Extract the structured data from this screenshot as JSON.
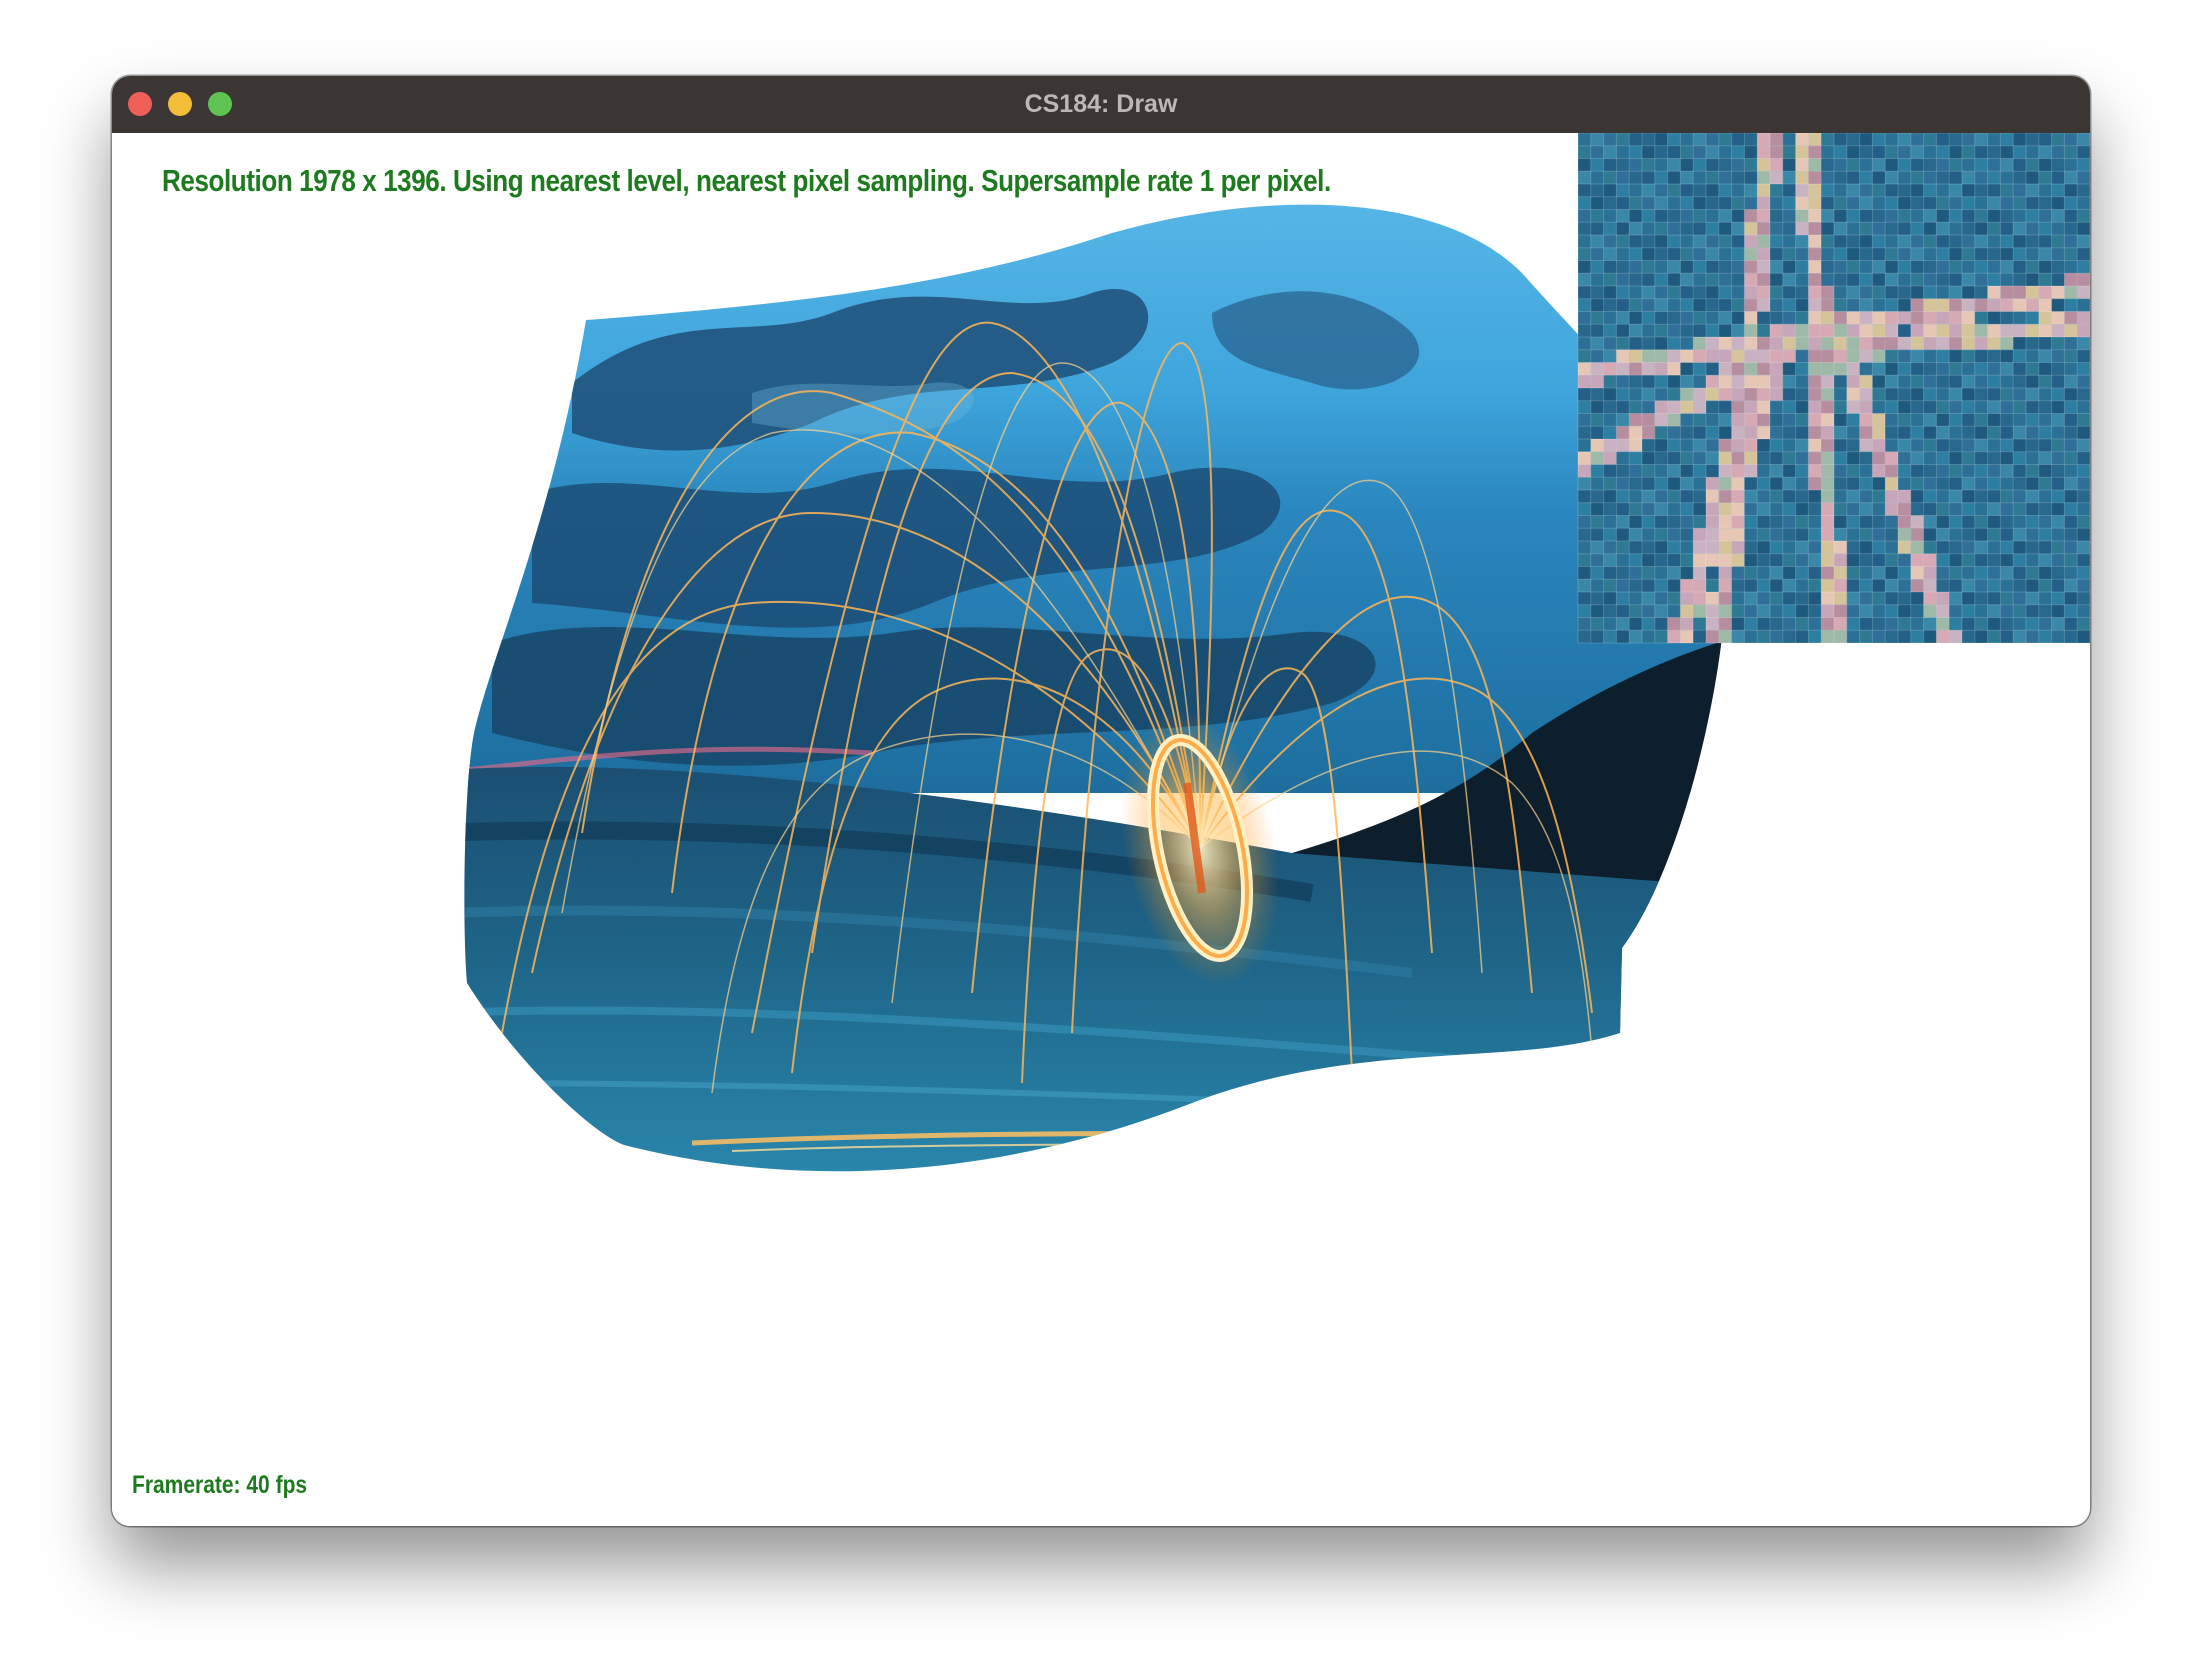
{
  "window": {
    "title": "CS184: Draw"
  },
  "overlay": {
    "status": "Resolution 1978 x 1396. Using nearest level, nearest pixel sampling. Supersample rate 1 per pixel.",
    "framerate": "Framerate: 40 fps"
  },
  "colors": {
    "titlebar": "#3b3533",
    "close": "#ee5f57",
    "minimize": "#f4bd3b",
    "zoom": "#60c454",
    "overlay_text": "#1e7a1e",
    "sky": "#3aa3d6",
    "water": "#1d5f80",
    "spark": "#ffb454"
  },
  "icons": {
    "close": "traffic-light-close-icon",
    "minimize": "traffic-light-minimize-icon",
    "zoom": "traffic-light-zoom-icon"
  }
}
